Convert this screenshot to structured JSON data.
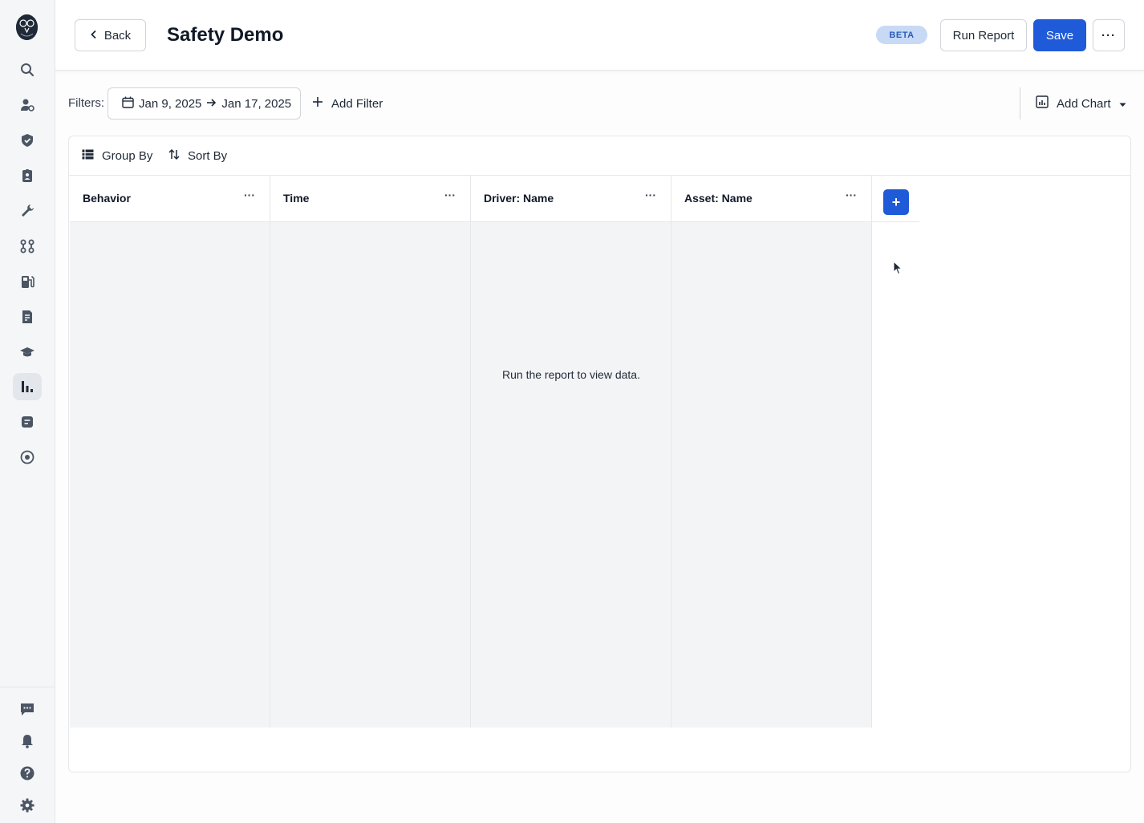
{
  "header": {
    "back_label": "Back",
    "title": "Safety Demo",
    "badge": "BETA",
    "run_report_label": "Run Report",
    "save_label": "Save",
    "more_label": "···"
  },
  "filters": {
    "label": "Filters:",
    "date_start": "Jan 9, 2025",
    "date_end": "Jan 17, 2025",
    "add_filter_label": "Add Filter",
    "add_chart_label": "Add Chart"
  },
  "toolbar": {
    "group_by_label": "Group By",
    "sort_by_label": "Sort By"
  },
  "table": {
    "columns": [
      {
        "label": "Behavior",
        "menu": "···"
      },
      {
        "label": "Time",
        "menu": "···"
      },
      {
        "label": "Driver: Name",
        "menu": "···"
      },
      {
        "label": "Asset: Name",
        "menu": "···"
      }
    ],
    "add_column_label": "+",
    "empty_message": "Run the report to view data."
  },
  "sidebar": {
    "icons": [
      "search-icon",
      "driver-icon",
      "shield-icon",
      "id-badge-icon",
      "wrench-icon",
      "route-icon",
      "fuel-icon",
      "document-icon",
      "graduation-cap-icon",
      "bar-chart-icon",
      "message-icon",
      "target-icon",
      "chat-icon",
      "bell-icon",
      "help-icon",
      "gear-icon"
    ],
    "active": "bar-chart-icon"
  },
  "colors": {
    "accent": "#1f5ad8",
    "badge_bg": "#c7d9f5",
    "badge_text": "#2b5cb8"
  }
}
